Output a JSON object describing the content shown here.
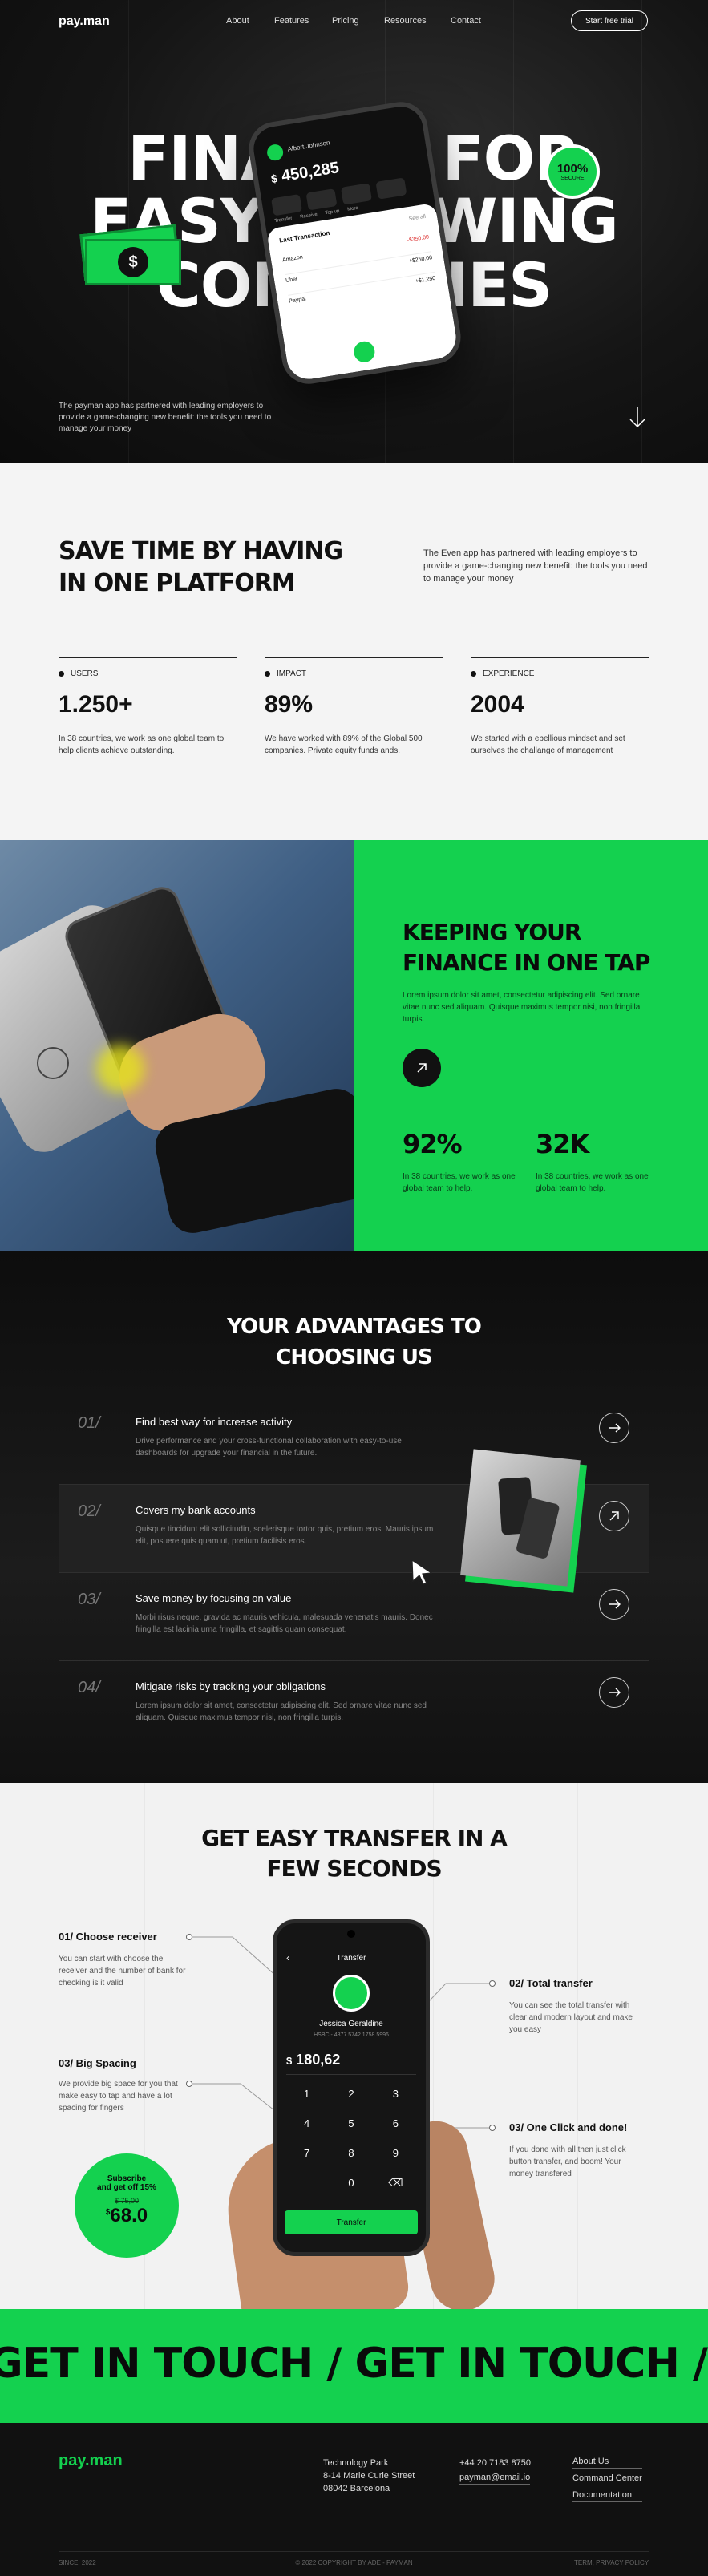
{
  "nav": {
    "logo": "pay.man",
    "links": [
      "About",
      "Features",
      "Pricing",
      "Resources",
      "Contact"
    ],
    "cta": "Start free trial"
  },
  "hero": {
    "line1": "FINANCE FOR",
    "line2": "EASY GROWING",
    "line3": "COMPANIES",
    "text": "The payman app has partnered with leading employers to provide a game-changing new benefit: the tools you need to manage your money",
    "badge_pct": "100%",
    "badge_sub": "SECURE",
    "phone": {
      "user": "Albert Johnson",
      "balance": "450,285",
      "actions": [
        "Transfer",
        "Receive",
        "Top up",
        "More"
      ],
      "section": "Last Transaction",
      "see_all": "See all",
      "transactions": [
        {
          "name": "Amazon",
          "amount": "-$350.00"
        },
        {
          "name": "Uber",
          "amount": "+$250.00"
        },
        {
          "name": "Paypal",
          "amount": "+$1,250"
        }
      ]
    }
  },
  "stats": {
    "title_l1": "SAVE TIME BY HAVING",
    "title_l2": "IN ONE PLATFORM",
    "intro": "The Even app has partnered with leading employers to provide a game-changing new benefit: the tools you need to manage your money",
    "items": [
      {
        "label": "USERS",
        "value": "1.250+",
        "desc": "In 38 countries, we work as one global team to help clients achieve outstanding."
      },
      {
        "label": "IMPACT",
        "value": "89%",
        "desc": "We have worked with 89% of the Global 500 companies. Private equity funds ands."
      },
      {
        "label": "EXPERIENCE",
        "value": "2004",
        "desc": "We started with a ebellious mindset and set ourselves the challange of management"
      }
    ]
  },
  "keep": {
    "title_l1": "KEEPING YOUR",
    "title_l2": "FINANCE IN ONE TAP",
    "desc": "Lorem ipsum dolor sit amet, consectetur adipiscing elit. Sed ornare vitae nunc sed aliquam. Quisque maximus tempor nisi, non fringilla turpis.",
    "stats": [
      {
        "value": "92%",
        "desc": "In 38 countries, we work as one global team to help."
      },
      {
        "value": "32K",
        "desc": "In 38 countries, we work as one global team to help."
      }
    ]
  },
  "advantages": {
    "title_l1": "YOUR ADVANTAGES TO",
    "title_l2": "CHOOSING US",
    "items": [
      {
        "num": "01/",
        "title": "Find best way for increase activity",
        "desc": "Drive performance and your cross-functional collaboration with easy-to-use dashboards for upgrade your financial in the future."
      },
      {
        "num": "02/",
        "title": "Covers my bank accounts",
        "desc": "Quisque tincidunt elit sollicitudin, scelerisque tortor quis, pretium eros. Mauris ipsum elit, posuere quis quam ut, pretium facilisis eros."
      },
      {
        "num": "03/",
        "title": "Save money by focusing on value",
        "desc": "Morbi risus neque, gravida ac mauris vehicula, malesuada venenatis mauris. Donec fringilla est lacinia urna fringilla, et sagittis quam consequat."
      },
      {
        "num": "04/",
        "title": "Mitigate risks by tracking your obligations",
        "desc": "Lorem ipsum dolor sit amet, consectetur adipiscing elit. Sed ornare vitae nunc sed aliquam. Quisque maximus tempor nisi, non fringilla turpis."
      }
    ]
  },
  "transfer": {
    "title_l1": "GET EASY TRANSFER IN A",
    "title_l2": "FEW SECONDS",
    "points": [
      {
        "title": "01/ Choose receiver",
        "desc": "You can start with choose the receiver and the number of bank for checking is it valid"
      },
      {
        "title": "02/ Total transfer",
        "desc": "You can see the total transfer with clear and modern layout and make you easy"
      },
      {
        "title": "03/ Big Spacing",
        "desc": "We provide big space for you that make easy to tap and have a lot spacing for fingers"
      },
      {
        "title": "03/ One Click and done!",
        "desc": "If you done with all then just click button transfer, and boom! Your money transfered"
      }
    ],
    "promo": {
      "line1": "Subscribe",
      "line2": "and get off 15%",
      "old_price": "$ 75,00",
      "price": "68.0",
      "currency": "$"
    },
    "phone": {
      "header": "Transfer",
      "name": "Jessica Geraldine",
      "account": "HSBC - 4877 5742 1758 5996",
      "amount": "180,62",
      "keys": [
        "1",
        "2",
        "3",
        "4",
        "5",
        "6",
        "7",
        "8",
        "9",
        "0"
      ],
      "button": "Transfer"
    }
  },
  "marquee": {
    "text": "GET IN TOUCH / GET IN TOUCH / GET IN TOUCH / GET IN TOUCH"
  },
  "footer": {
    "logo": "pay.man",
    "address": [
      "Technology Park",
      "8-14 Marie Curie Street",
      "08042 Barcelona"
    ],
    "phone": "+44 20 7183 8750",
    "email": "payman@email.io",
    "links": [
      "About Us",
      "Command Center",
      "Documentation"
    ],
    "since": "SINCE, 2022",
    "copyright": "© 2022 COPYRIGHT BY ADE - PAYMAN",
    "terms": "TERM, PRIVACY POLICY"
  },
  "colors": {
    "accent": "#14d14f",
    "dark": "#111111",
    "light": "#f4f4f4"
  }
}
